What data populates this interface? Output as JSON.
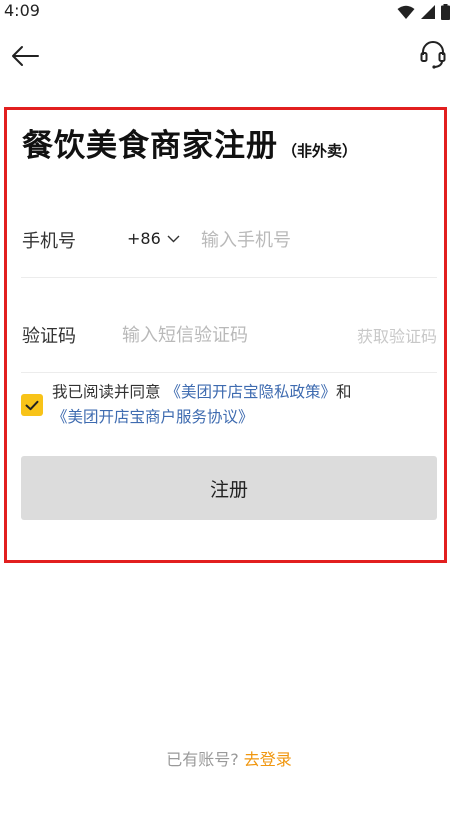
{
  "status_bar": {
    "time": "4:09",
    "icons": [
      "wifi-icon",
      "signal-icon",
      "battery-icon"
    ]
  },
  "header": {
    "back_icon": "arrow-left-icon",
    "service_icon": "headset-icon"
  },
  "form": {
    "title": "餐饮美食商家注册",
    "subtitle": "（非外卖）",
    "phone_label": "手机号",
    "country_code": "+86",
    "phone_placeholder": "输入手机号",
    "phone_value": "",
    "code_label": "验证码",
    "code_placeholder": "输入短信验证码",
    "code_value": "",
    "get_code_label": "获取验证码",
    "agreement": {
      "checked": true,
      "prefix": "我已阅读并同意",
      "privacy_link": "《美团开店宝隐私政策》",
      "conjunction": "和",
      "service_link": "《美团开店宝商户服务协议》"
    },
    "register_label": "注册"
  },
  "footer": {
    "login_hint": "已有账号?",
    "login_link": "去登录"
  },
  "colors": {
    "highlight_border": "#e21f1f",
    "checkbox": "#f8c318",
    "link": "#3e6bb0",
    "login_link": "#f0960e",
    "button_bg": "#dcdcdc"
  }
}
